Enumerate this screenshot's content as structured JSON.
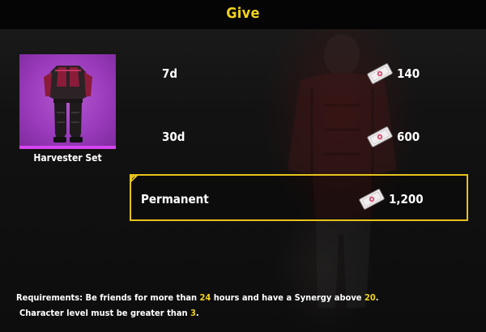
{
  "header": {
    "title": "Give",
    "title_color": "#f2d21b"
  },
  "item": {
    "name": "Harvester Set",
    "icon": "outfit-icon",
    "rarity_color": "#d645f0"
  },
  "options": [
    {
      "duration": "7d",
      "price": "140",
      "currency_icon": "voucher-icon",
      "selected": false
    },
    {
      "duration": "30d",
      "price": "600",
      "currency_icon": "voucher-icon",
      "selected": false
    },
    {
      "duration": "Permanent",
      "price": "1,200",
      "currency_icon": "voucher-icon",
      "selected": true
    }
  ],
  "requirements": {
    "line1_prefix": "Requirements: Be friends for more than ",
    "hours": "24",
    "line1_middle": " hours and have a Synergy above ",
    "synergy": "20",
    "line1_suffix": ".",
    "line2_prefix": "Character level must be greater than ",
    "level": "3",
    "line2_suffix": ".",
    "highlight_color": "#f2d21b"
  }
}
